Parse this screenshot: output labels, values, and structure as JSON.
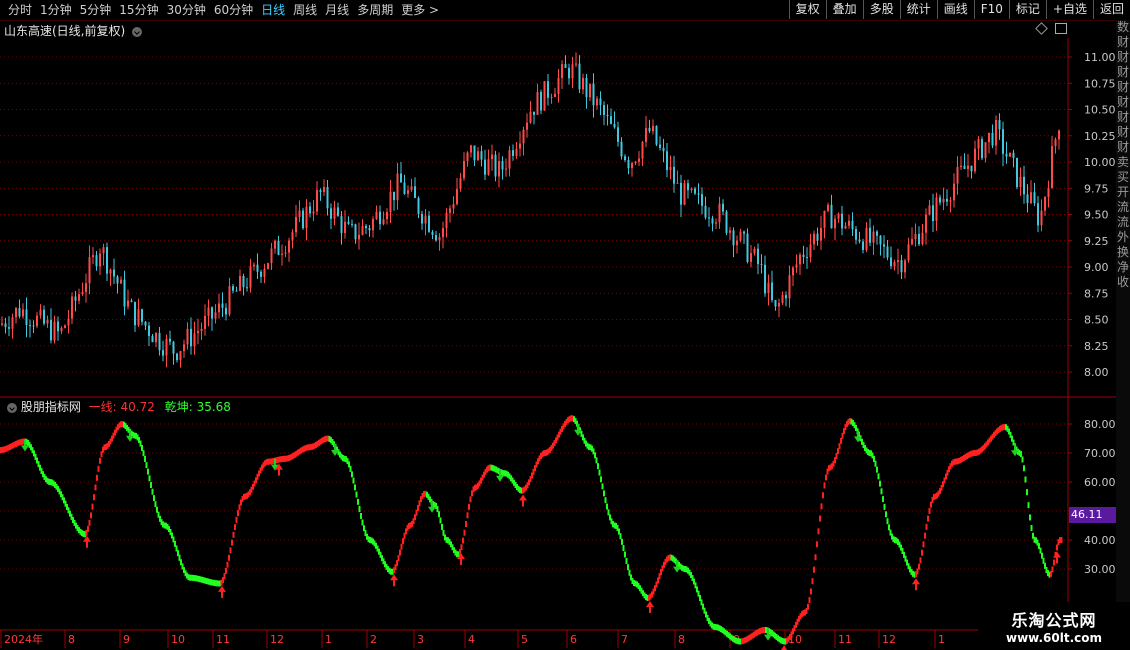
{
  "toolbar": {
    "periods": [
      "分时",
      "1分钟",
      "5分钟",
      "15分钟",
      "30分钟",
      "60分钟",
      "日线",
      "周线",
      "月线",
      "多周期",
      "更多 >"
    ],
    "active_period": "日线",
    "actions": [
      "复权",
      "叠加",
      "多股",
      "统计",
      "画线",
      "F10",
      "标记",
      "+自选",
      "返回"
    ]
  },
  "main_chart": {
    "title": "山东高速(日线,前复权)",
    "y_ticks": [
      "11.00",
      "10.75",
      "10.50",
      "10.25",
      "10.00",
      "9.75",
      "9.50",
      "9.25",
      "9.00",
      "8.75",
      "8.50",
      "8.25",
      "8.00"
    ],
    "up_color": "#ff4a4a",
    "down_color": "#3fc8e0"
  },
  "indicator": {
    "name": "股朋指标网",
    "line1_label": "一线: 40.72",
    "line2_label": "乾坤: 35.68",
    "y_ticks": [
      "80.00",
      "70.00",
      "60.00",
      "50.00",
      "40.00",
      "30.00"
    ],
    "current_value": "46.11"
  },
  "x_axis": {
    "labels": [
      "2024年",
      "8",
      "9",
      "10",
      "11",
      "12",
      "1",
      "2",
      "3",
      "4",
      "5",
      "6",
      "7",
      "8",
      "9",
      "10",
      "11",
      "12",
      "1"
    ]
  },
  "side_strip": [
    "数",
    "财",
    "财",
    "财",
    "财",
    "财",
    "财",
    "财",
    "财",
    "卖",
    "买",
    "开",
    "流",
    "流",
    "外",
    "换",
    "净",
    "收"
  ],
  "watermark": {
    "line1": "乐淘公式网",
    "line2": "www.60lt.com"
  },
  "colors": {
    "grid": "#7a0000",
    "up": "#ff2020",
    "down": "#20ff20",
    "badge": "#5a1aa0"
  }
}
